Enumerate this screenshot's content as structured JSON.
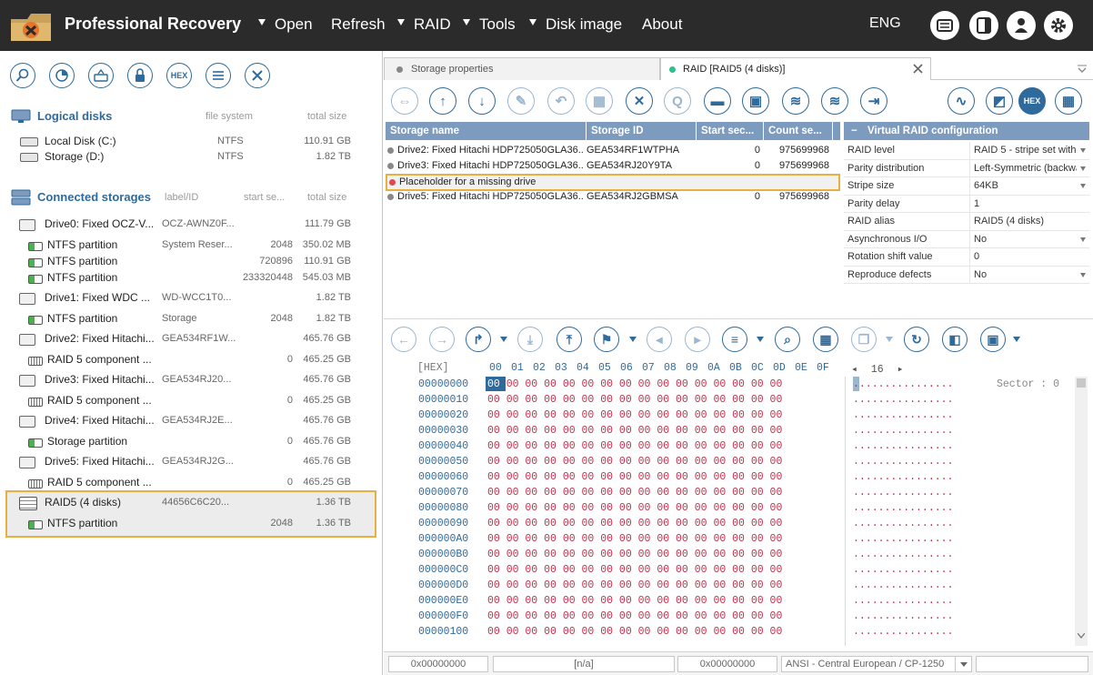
{
  "app": {
    "title": "Professional Recovery"
  },
  "menu": [
    {
      "label": "Open",
      "has_arrow": true
    },
    {
      "label": "Refresh",
      "has_arrow": false
    },
    {
      "label": "RAID",
      "has_arrow": true
    },
    {
      "label": "Tools",
      "has_arrow": true
    },
    {
      "label": "Disk image",
      "has_arrow": true
    },
    {
      "label": "About",
      "has_arrow": false
    }
  ],
  "lang": "ENG",
  "top_buttons": [
    "news-icon",
    "layout-icon",
    "user-icon",
    "settings-icon"
  ],
  "left_toolbar": [
    "search-icon",
    "scan-icon",
    "disk-image-icon",
    "lock-icon",
    "hex-icon",
    "list-icon",
    "close-icon"
  ],
  "left_toolbar_hex_label": "HEX",
  "logical": {
    "title": "Logical disks",
    "col_fs": "file system",
    "col_size": "total size",
    "rows": [
      {
        "name": "Local Disk (C:)",
        "fs": "NTFS",
        "size": "110.91 GB"
      },
      {
        "name": "Storage (D:)",
        "fs": "NTFS",
        "size": "1.82 TB"
      }
    ]
  },
  "connected": {
    "title": "Connected storages",
    "col_label": "label/ID",
    "col_start": "start se...",
    "col_size": "total size",
    "rows": [
      {
        "name": "Drive0: Fixed OCZ-V...",
        "label": "OCZ-AWNZ0F...",
        "start": "",
        "size": "111.79 GB",
        "kind": "drive",
        "indent": 0
      },
      {
        "name": "NTFS partition",
        "label": "System Reser...",
        "start": "2048",
        "size": "350.02 MB",
        "kind": "part",
        "indent": 1
      },
      {
        "name": "NTFS partition",
        "label": "",
        "start": "720896",
        "size": "110.91 GB",
        "kind": "part",
        "indent": 1
      },
      {
        "name": "NTFS partition",
        "label": "",
        "start": "233320448",
        "size": "545.03 MB",
        "kind": "part",
        "indent": 1
      },
      {
        "name": "Drive1: Fixed WDC ...",
        "label": "WD-WCC1T0...",
        "start": "",
        "size": "1.82 TB",
        "kind": "drive",
        "indent": 0
      },
      {
        "name": "NTFS partition",
        "label": "Storage",
        "start": "2048",
        "size": "1.82 TB",
        "kind": "part",
        "indent": 1
      },
      {
        "name": "Drive2: Fixed Hitachi...",
        "label": "GEA534RF1W...",
        "start": "",
        "size": "465.76 GB",
        "kind": "drive",
        "indent": 0
      },
      {
        "name": "RAID 5 component ...",
        "label": "",
        "start": "0",
        "size": "465.25 GB",
        "kind": "raidc",
        "indent": 1
      },
      {
        "name": "Drive3: Fixed Hitachi...",
        "label": "GEA534RJ20...",
        "start": "",
        "size": "465.76 GB",
        "kind": "drive",
        "indent": 0
      },
      {
        "name": "RAID 5 component ...",
        "label": "",
        "start": "0",
        "size": "465.25 GB",
        "kind": "raidc",
        "indent": 1
      },
      {
        "name": "Drive4: Fixed Hitachi...",
        "label": "GEA534RJ2E...",
        "start": "",
        "size": "465.76 GB",
        "kind": "drive",
        "indent": 0
      },
      {
        "name": "Storage partition",
        "label": "",
        "start": "0",
        "size": "465.76 GB",
        "kind": "part",
        "indent": 1
      },
      {
        "name": "Drive5: Fixed Hitachi...",
        "label": "GEA534RJ2G...",
        "start": "",
        "size": "465.76 GB",
        "kind": "drive",
        "indent": 0
      },
      {
        "name": "RAID 5 component ...",
        "label": "",
        "start": "0",
        "size": "465.25 GB",
        "kind": "raidc",
        "indent": 1
      },
      {
        "name": "RAID5 (4 disks)",
        "label": "44656C6C20...",
        "start": "",
        "size": "1.36 TB",
        "kind": "raid",
        "indent": 0
      },
      {
        "name": "NTFS partition",
        "label": "",
        "start": "2048",
        "size": "1.36 TB",
        "kind": "part",
        "indent": 1
      }
    ]
  },
  "tabs": [
    {
      "label": "Storage properties",
      "dot": "#888888"
    },
    {
      "label": "RAID [RAID5 (4 disks)]",
      "dot": "#2fbf8f"
    }
  ],
  "raid_toolbar_hex_label": "HEX",
  "raid_table": {
    "headers": [
      "Storage name",
      "Storage ID",
      "Start sec...",
      "Count se..."
    ],
    "rows": [
      {
        "name": "Drive2: Fixed Hitachi HDP725050GLA36...",
        "id": "GEA534RF1WTPHA",
        "start": "0",
        "count": "975699968",
        "dot": "#888888"
      },
      {
        "name": "Drive3: Fixed Hitachi HDP725050GLA36...",
        "id": "GEA534RJ20Y9TA",
        "start": "0",
        "count": "975699968",
        "dot": "#888888"
      },
      {
        "name": "Placeholder for a missing drive",
        "id": "",
        "start": "",
        "count": "",
        "dot": "#e04a4a"
      },
      {
        "name": "Drive5: Fixed Hitachi HDP725050GLA36...",
        "id": "GEA534RJ2GBMSA",
        "start": "0",
        "count": "975699968",
        "dot": "#888888"
      }
    ]
  },
  "vraid": {
    "title": "Virtual RAID configuration",
    "collapse": "−",
    "rows": [
      {
        "label": "RAID level",
        "value": "RAID 5 - stripe set with",
        "dropdown": true
      },
      {
        "label": "Parity distribution",
        "value": "Left-Symmetric (backwa",
        "dropdown": true
      },
      {
        "label": "Stripe size",
        "value": "64KB",
        "dropdown": true
      },
      {
        "label": "Parity delay",
        "value": "1",
        "dropdown": false
      },
      {
        "label": "RAID alias",
        "value": "RAID5 (4 disks)",
        "dropdown": false
      },
      {
        "label": "Asynchronous I/O",
        "value": "No",
        "dropdown": true
      },
      {
        "label": "Rotation shift value",
        "value": "0",
        "dropdown": false
      },
      {
        "label": "Reproduce defects",
        "value": "No",
        "dropdown": true
      }
    ]
  },
  "hex": {
    "label": "[HEX]",
    "columns": [
      "00",
      "01",
      "02",
      "03",
      "04",
      "05",
      "06",
      "07",
      "08",
      "09",
      "0A",
      "0B",
      "0C",
      "0D",
      "0E",
      "0F"
    ],
    "width_nav": "16",
    "sector_label": "Sector : 0",
    "first_byte": "00",
    "bytes_rest": "   00 00 00 00 00 00 00 00 00 00 00 00 00 00 00",
    "bytes_row": "00 00 00 00 00 00 00 00 00 00 00 00 00 00 00 00",
    "dots": "................",
    "addresses": [
      "00000000",
      "00000010",
      "00000020",
      "00000030",
      "00000040",
      "00000050",
      "00000060",
      "00000070",
      "00000080",
      "00000090",
      "000000A0",
      "000000B0",
      "000000C0",
      "000000D0",
      "000000E0",
      "000000F0",
      "00000100"
    ]
  },
  "status": {
    "offset": "0x00000000",
    "na": "[n/a]",
    "offset2": "0x00000000",
    "encoding": "ANSI - Central European / CP-1250"
  }
}
